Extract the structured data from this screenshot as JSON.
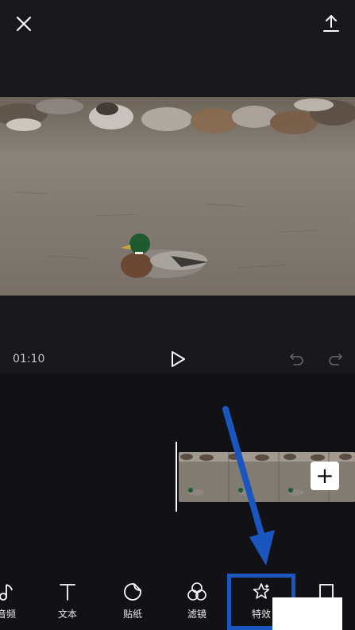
{
  "header": {
    "close_icon": "close-icon",
    "export_icon": "export-upload-icon"
  },
  "player": {
    "timecode": "01:10",
    "play_icon": "play-icon",
    "undo_icon": "undo-icon",
    "redo_icon": "redo-icon"
  },
  "timeline": {
    "add_label": "+"
  },
  "toolbar": {
    "items": [
      {
        "label": "音频",
        "icon": "music-note-icon"
      },
      {
        "label": "文本",
        "icon": "text-t-icon"
      },
      {
        "label": "贴纸",
        "icon": "sticker-icon"
      },
      {
        "label": "滤镜",
        "icon": "filter-circles-icon"
      },
      {
        "label": "特效",
        "icon": "effects-star-icon"
      },
      {
        "label": "",
        "icon": "format-rectangle-icon"
      }
    ]
  },
  "annotation": {
    "highlight_color": "#1a55c0",
    "arrow_color": "#1a55c0"
  }
}
